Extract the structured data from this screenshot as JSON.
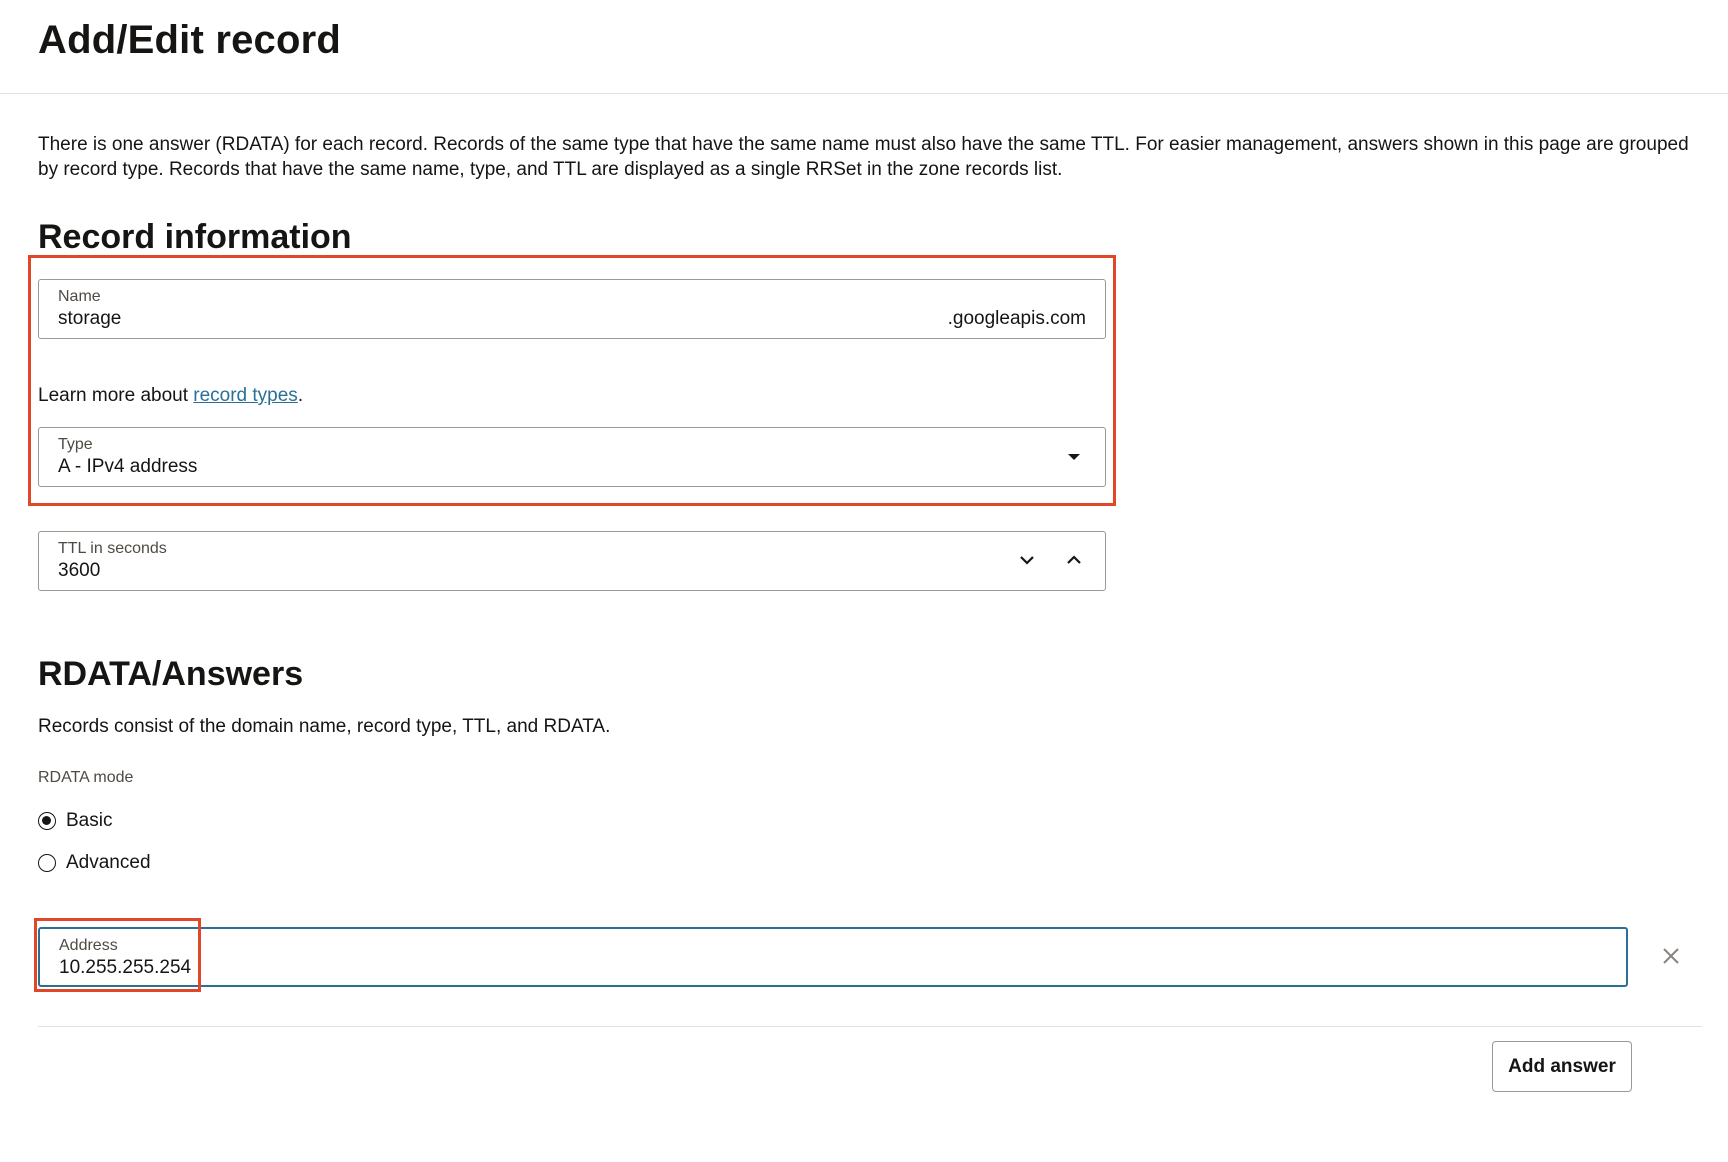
{
  "header": {
    "title": "Add/Edit record"
  },
  "intro": "There is one answer (RDATA) for each record. Records of the same type that have the same name must also have the same TTL. For easier management, answers shown in this page are grouped by record type. Records that have the same name, type, and TTL are displayed as a single RRSet in the zone records list.",
  "record_info": {
    "title": "Record information",
    "name": {
      "label": "Name",
      "value": "storage",
      "suffix": ".googleapis.com"
    },
    "learn_prefix": "Learn more about ",
    "learn_link": "record types",
    "learn_suffix": ".",
    "type": {
      "label": "Type",
      "value": "A - IPv4 address"
    },
    "ttl": {
      "label": "TTL in seconds",
      "value": "3600"
    }
  },
  "rdata": {
    "title": "RDATA/Answers",
    "description": "Records consist of the domain name, record type, TTL, and RDATA.",
    "mode_label": "RDATA mode",
    "modes": [
      {
        "label": "Basic",
        "checked": true
      },
      {
        "label": "Advanced",
        "checked": false
      }
    ],
    "address": {
      "label": "Address",
      "value": "10.255.255.254"
    },
    "add_answer": "Add answer"
  },
  "colors": {
    "highlight": "#e04628",
    "link": "#2b6f97",
    "focus_border": "#2b6f97"
  },
  "icons": [
    "caret-down-icon",
    "chevron-down-icon",
    "chevron-up-icon",
    "close-icon"
  ]
}
